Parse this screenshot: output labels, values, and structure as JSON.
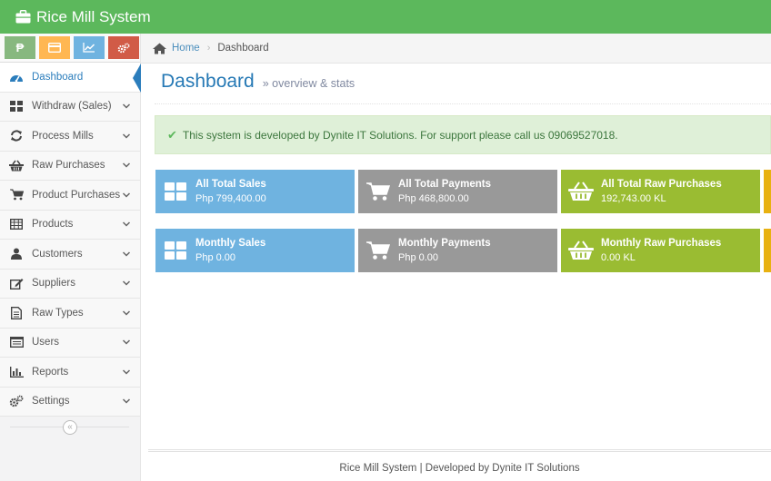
{
  "app": {
    "title": "Rice Mill System",
    "brand_icon": "briefcase-icon",
    "accent": "#5cb85c"
  },
  "shortcuts": [
    {
      "icon": "peso-icon",
      "glyph": "₱",
      "color": "#87b87f"
    },
    {
      "icon": "credit-card-icon",
      "color": "#ffb752"
    },
    {
      "icon": "line-chart-icon",
      "color": "#6fb3e0"
    },
    {
      "icon": "cogs-icon",
      "color": "#d15b47"
    }
  ],
  "sidebar": {
    "items": [
      {
        "label": "Dashboard",
        "icon": "tachometer-icon",
        "active": true
      },
      {
        "label": "Withdraw (Sales)",
        "icon": "grid-icon"
      },
      {
        "label": "Process Mills",
        "icon": "refresh-icon"
      },
      {
        "label": "Raw Purchases",
        "icon": "basket-icon"
      },
      {
        "label": "Product Purchases",
        "icon": "cart-icon"
      },
      {
        "label": "Products",
        "icon": "table-icon"
      },
      {
        "label": "Customers",
        "icon": "user-icon"
      },
      {
        "label": "Suppliers",
        "icon": "edit-icon"
      },
      {
        "label": "Raw Types",
        "icon": "file-icon"
      },
      {
        "label": "Users",
        "icon": "list-icon"
      },
      {
        "label": "Reports",
        "icon": "bar-chart-icon"
      },
      {
        "label": "Settings",
        "icon": "cogs-icon"
      }
    ],
    "collapse_glyph": "«"
  },
  "breadcrumb": {
    "home": "Home",
    "current": "Dashboard"
  },
  "page": {
    "title": "Dashboard",
    "subtitle": "overview & stats",
    "subtitle_prefix": "»"
  },
  "alert": {
    "text": "This system is developed by Dynite IT Solutions. For support please call us 09069527018.",
    "icon": "check-icon"
  },
  "tiles_row1": [
    {
      "title": "All Total Sales",
      "value": "Php 799,400.00",
      "icon": "windows-icon",
      "color": "#6fb3e0"
    },
    {
      "title": "All Total Payments",
      "value": "Php 468,800.00",
      "icon": "cart-icon",
      "color": "#999999"
    },
    {
      "title": "All Total Raw Purchases",
      "value": "192,743.00 KL",
      "icon": "basket-icon",
      "color": "#9abc32"
    }
  ],
  "tiles_row2": [
    {
      "title": "Monthly Sales",
      "value": "Php 0.00",
      "icon": "windows-icon",
      "color": "#6fb3e0"
    },
    {
      "title": "Monthly Payments",
      "value": "Php 0.00",
      "icon": "cart-icon",
      "color": "#999999"
    },
    {
      "title": "Monthly Raw Purchases",
      "value": "0.00 KL",
      "icon": "basket-icon",
      "color": "#9abc32"
    }
  ],
  "footer": {
    "text": "Rice Mill System | Developed by Dynite IT Solutions"
  }
}
